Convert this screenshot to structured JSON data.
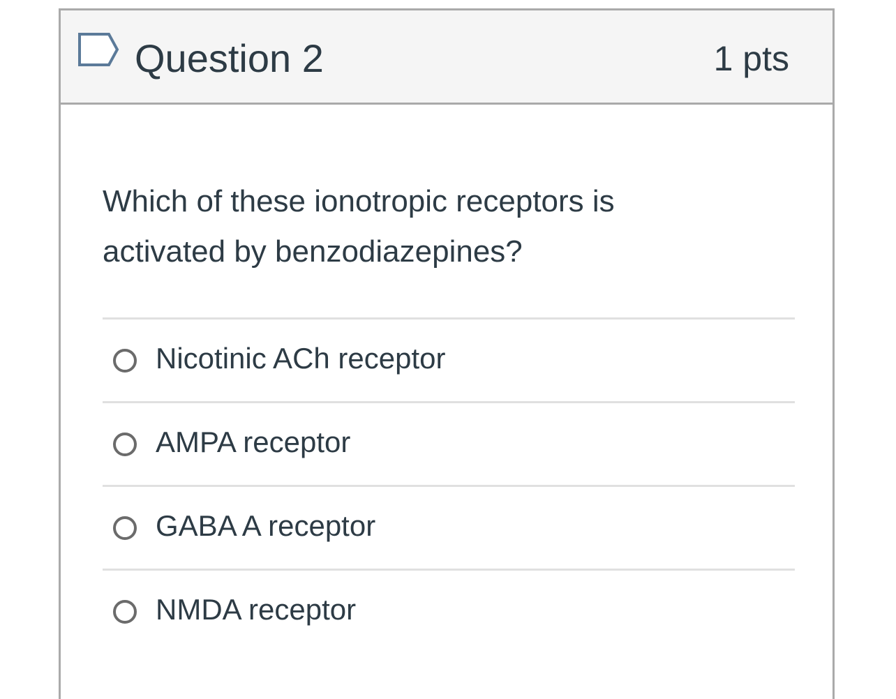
{
  "question": {
    "title": "Question 2",
    "points": "1 pts",
    "flag_icon": "flag-outline-icon",
    "text": "Which of these ionotropic receptors is activated by benzodiazepines?"
  },
  "answers": [
    {
      "label": "Nicotinic ACh receptor",
      "selected": false
    },
    {
      "label": "AMPA receptor",
      "selected": false
    },
    {
      "label": "GABA A receptor",
      "selected": false
    },
    {
      "label": "NMDA receptor",
      "selected": false
    }
  ],
  "colors": {
    "text": "#2d3b45",
    "border": "#aaaaaa",
    "header_bg": "#f5f5f5",
    "flag_stroke": "#5b7a99",
    "radio_border": "#6b6b6b"
  }
}
